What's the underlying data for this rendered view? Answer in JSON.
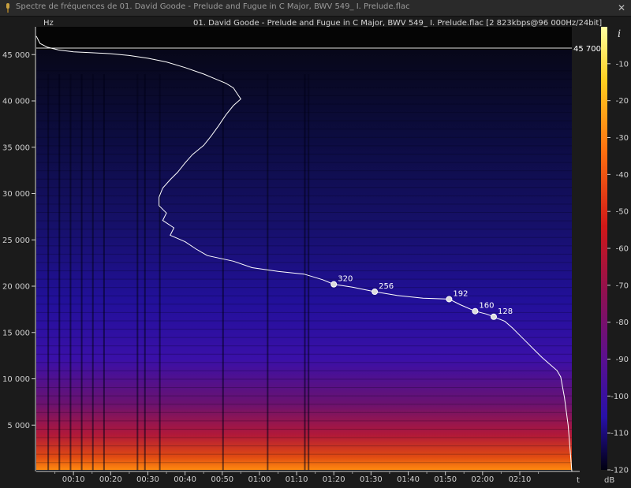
{
  "window": {
    "title": "Spectre de fréquences de 01. David Goode - Prelude and Fugue in C Major, BWV 549_ I. Prelude.flac",
    "close_symbol": "✕",
    "info_symbol": "i"
  },
  "chart_data": {
    "type": "heatmap",
    "title": "01. David Goode - Prelude and Fugue in C Major, BWV 549_ I. Prelude.flac [2 823kbps@96 000Hz/24bit]",
    "xlabel": "t",
    "ylabel": "Hz",
    "x_ticks": [
      "00:10",
      "00:20",
      "00:30",
      "00:40",
      "00:50",
      "01:00",
      "01:10",
      "01:20",
      "01:30",
      "01:40",
      "01:50",
      "02:00",
      "02:10"
    ],
    "x_tick_seconds": [
      10,
      20,
      30,
      40,
      50,
      60,
      70,
      80,
      90,
      100,
      110,
      120,
      130
    ],
    "xlim_seconds": [
      0,
      144
    ],
    "y_ticks": [
      "5 000",
      "10 000",
      "15 000",
      "20 000",
      "25 000",
      "30 000",
      "35 000",
      "40 000",
      "45 000"
    ],
    "y_tick_values": [
      5000,
      10000,
      15000,
      20000,
      25000,
      30000,
      35000,
      40000,
      45000
    ],
    "ylim": [
      0,
      48000
    ],
    "colorbar": {
      "label": "dB",
      "ticks": [
        "-10",
        "-20",
        "-30",
        "-40",
        "-50",
        "-60",
        "-70",
        "-80",
        "-90",
        "-100",
        "-110",
        "-120"
      ],
      "tick_values": [
        -10,
        -20,
        -30,
        -40,
        -50,
        -60,
        -70,
        -80,
        -90,
        -100,
        -110,
        -120
      ],
      "range": [
        -120,
        0
      ]
    },
    "cutoff_line": {
      "value": 45700,
      "label": "45 700"
    },
    "bitrate_markers": [
      {
        "label": "320",
        "t": 80,
        "hz": 20200
      },
      {
        "label": "256",
        "t": 91,
        "hz": 19400
      },
      {
        "label": "192",
        "t": 111,
        "hz": 18600
      },
      {
        "label": "160",
        "t": 118,
        "hz": 17300
      },
      {
        "label": "128",
        "t": 123,
        "hz": 16700
      }
    ],
    "max_freq_curve": [
      [
        0,
        47000
      ],
      [
        1,
        46200
      ],
      [
        3,
        45800
      ],
      [
        6,
        45500
      ],
      [
        10,
        45300
      ],
      [
        15,
        45200
      ],
      [
        20,
        45100
      ],
      [
        25,
        44900
      ],
      [
        30,
        44600
      ],
      [
        35,
        44200
      ],
      [
        40,
        43600
      ],
      [
        45,
        42900
      ],
      [
        48,
        42400
      ],
      [
        51,
        41900
      ],
      [
        53,
        41400
      ],
      [
        54,
        40800
      ],
      [
        55,
        40200
      ],
      [
        53,
        39500
      ],
      [
        51,
        38500
      ],
      [
        49,
        37300
      ],
      [
        47,
        36200
      ],
      [
        45,
        35200
      ],
      [
        42,
        34200
      ],
      [
        40,
        33300
      ],
      [
        38,
        32300
      ],
      [
        36,
        31500
      ],
      [
        34,
        30600
      ],
      [
        33,
        29600
      ],
      [
        33,
        28700
      ],
      [
        35,
        27900
      ],
      [
        34,
        27100
      ],
      [
        37,
        26300
      ],
      [
        36,
        25500
      ],
      [
        40,
        24800
      ],
      [
        43,
        24000
      ],
      [
        46,
        23300
      ],
      [
        53,
        22700
      ],
      [
        58,
        22000
      ],
      [
        65,
        21600
      ],
      [
        72,
        21300
      ],
      [
        77,
        20700
      ],
      [
        80,
        20200
      ],
      [
        85,
        19900
      ],
      [
        91,
        19400
      ],
      [
        97,
        19000
      ],
      [
        104,
        18700
      ],
      [
        111,
        18600
      ],
      [
        114,
        18000
      ],
      [
        118,
        17300
      ],
      [
        121,
        17000
      ],
      [
        123,
        16700
      ],
      [
        126,
        16200
      ],
      [
        128,
        15500
      ],
      [
        130,
        14700
      ],
      [
        132,
        13900
      ],
      [
        134,
        13100
      ],
      [
        136,
        12300
      ],
      [
        138,
        11600
      ],
      [
        140,
        10900
      ],
      [
        141,
        10200
      ],
      [
        142,
        8000
      ],
      [
        143,
        5000
      ],
      [
        144,
        0
      ]
    ]
  }
}
